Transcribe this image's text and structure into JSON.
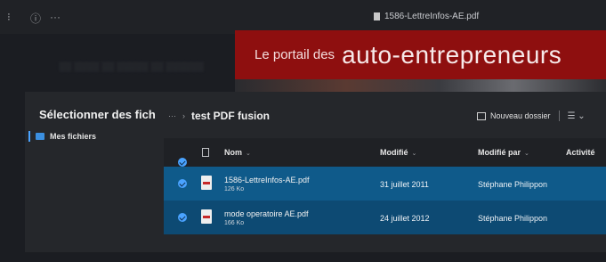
{
  "window": {
    "title": "1586-LettreInfos-AE.pdf"
  },
  "banner": {
    "prefix": "Le portail des",
    "main": "auto-entrepreneurs"
  },
  "dialog": {
    "title": "Sélectionner des fich",
    "sidebar": [
      {
        "label": "Mes fichiers"
      }
    ],
    "breadcrumb": {
      "ellipsis": "···",
      "separator": "›",
      "current": "test PDF fusion"
    },
    "toolbar": {
      "new_folder": "Nouveau dossier"
    },
    "columns": {
      "name": "Nom",
      "modified": "Modifié",
      "modified_by": "Modifié par",
      "activity": "Activité"
    },
    "files": [
      {
        "name": "1586-LettreInfos-AE.pdf",
        "size": "126 Ko",
        "modified": "31 juillet 2011",
        "modified_by": "Stéphane Philippon"
      },
      {
        "name": "mode operatoire AE.pdf",
        "size": "166 Ko",
        "modified": "24 juillet 2012",
        "modified_by": "Stéphane Philippon"
      }
    ]
  },
  "colors": {
    "accent": "#4aa3ff",
    "selected_row": "#0f5a8a",
    "banner": "#8e0f0f"
  }
}
